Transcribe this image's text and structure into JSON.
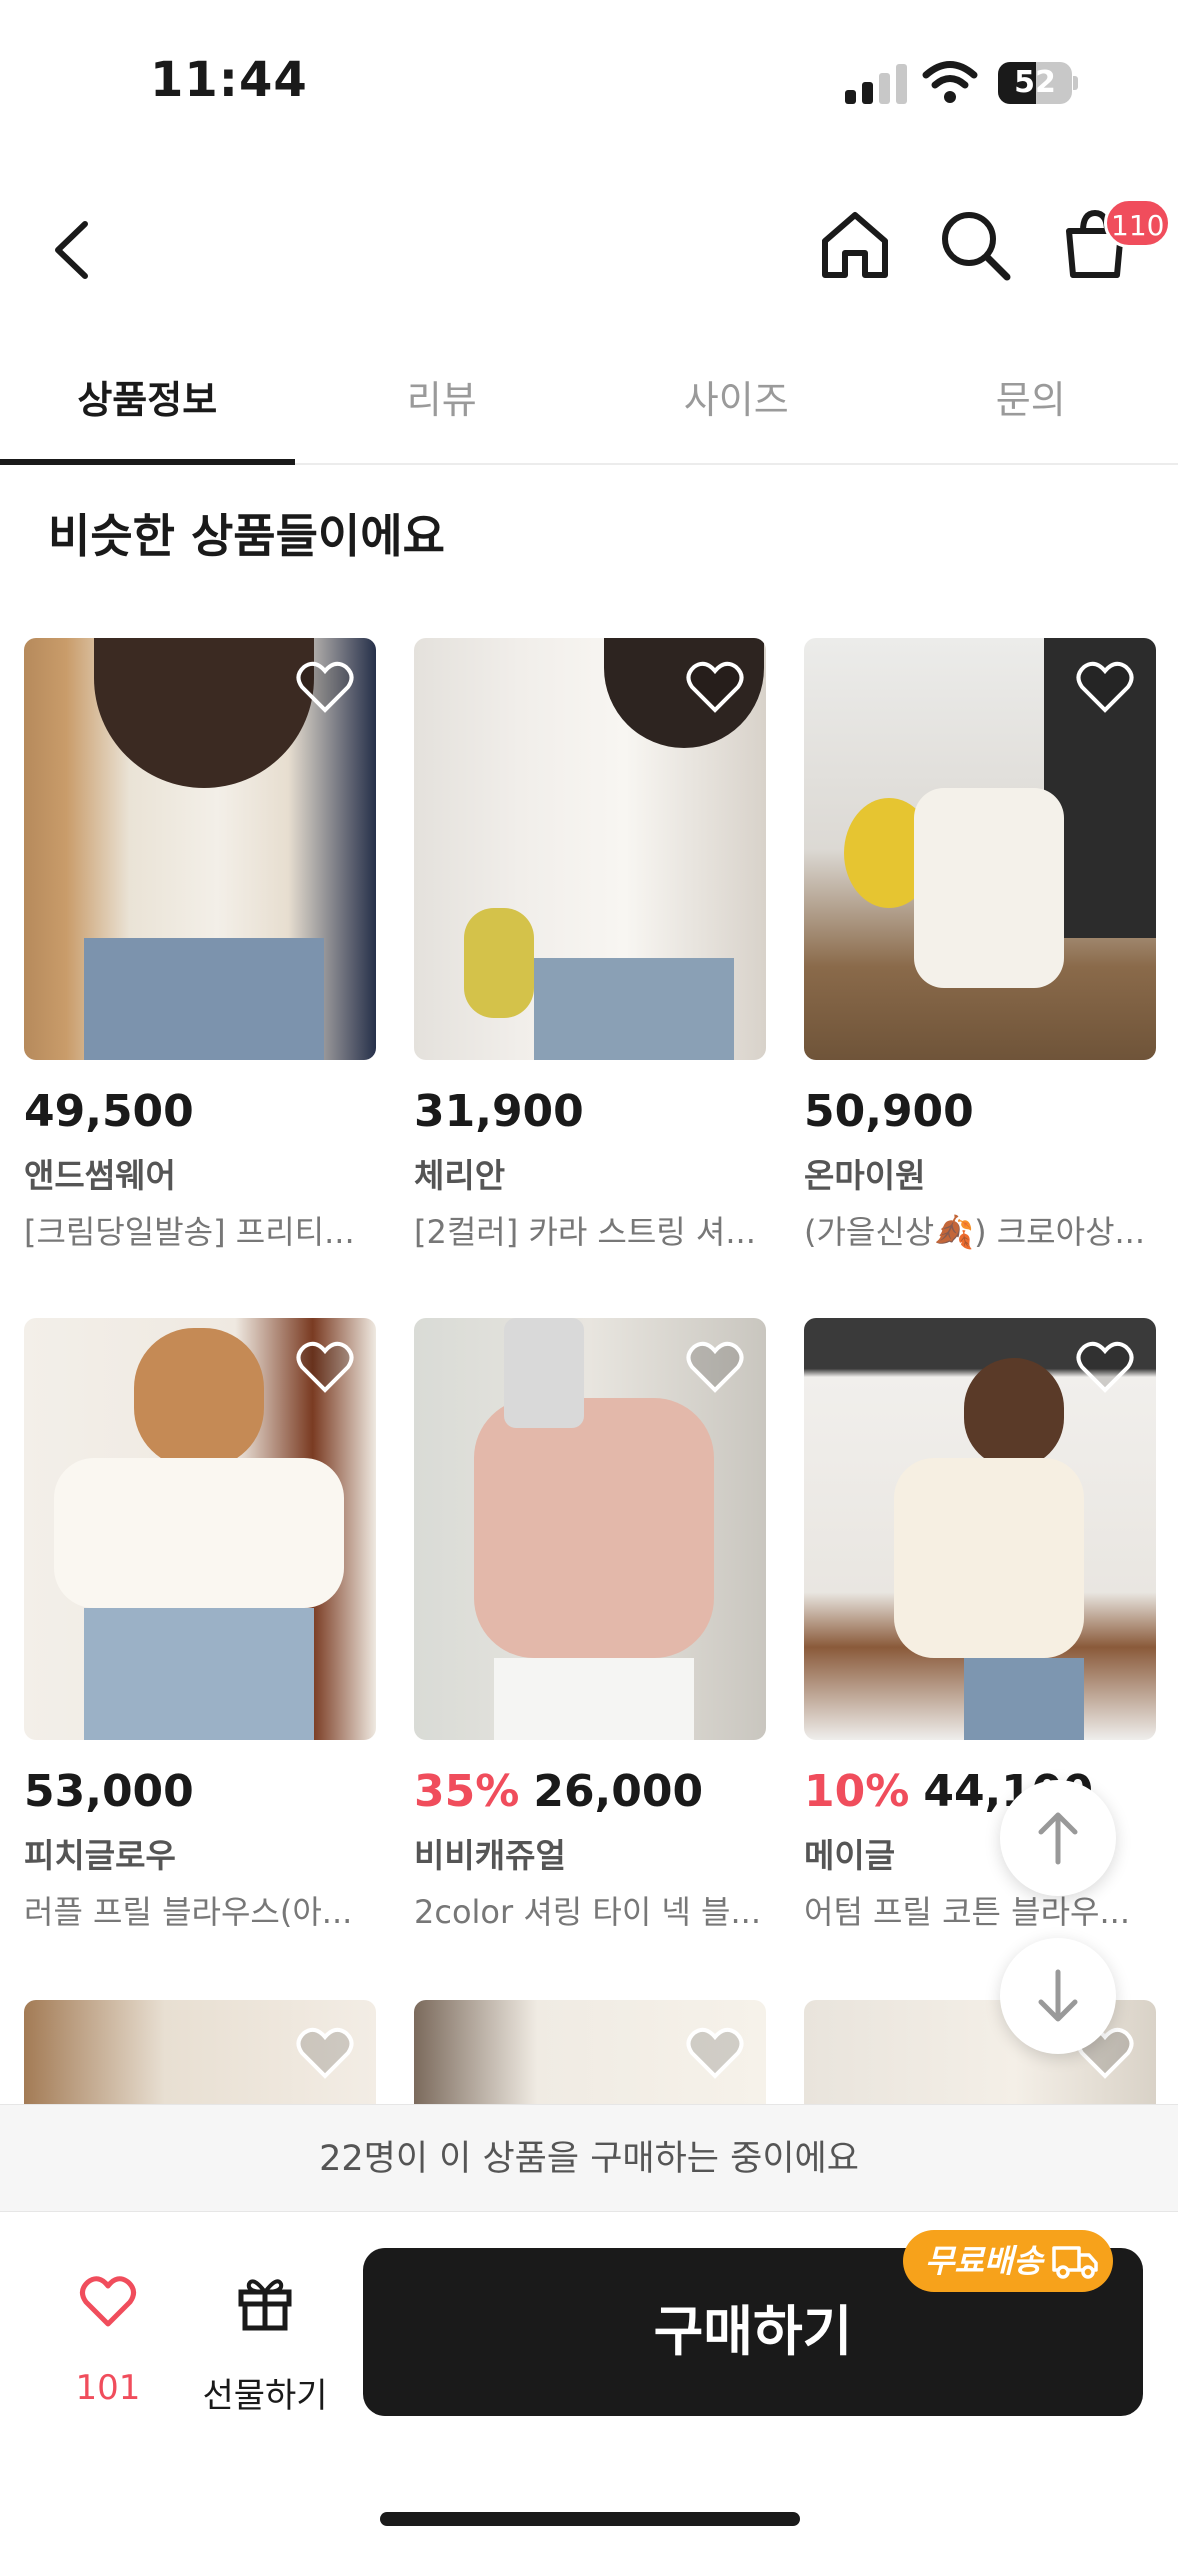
{
  "status_bar": {
    "time": "11:44",
    "battery": "52"
  },
  "header": {
    "cart_badge": "110"
  },
  "tabs": [
    {
      "label": "상품정보",
      "active": true
    },
    {
      "label": "리뷰",
      "active": false
    },
    {
      "label": "사이즈",
      "active": false
    },
    {
      "label": "문의",
      "active": false
    }
  ],
  "section": {
    "title": "비슷한 상품들이에요"
  },
  "products": [
    {
      "price": "49,500",
      "discount": "",
      "brand": "앤드썸웨어",
      "name": "[크림당일발송] 프리티..."
    },
    {
      "price": "31,900",
      "discount": "",
      "brand": "체리안",
      "name": "[2컬러] 카라 스트링 셔..."
    },
    {
      "price": "50,900",
      "discount": "",
      "brand": "온마이원",
      "name": "(가을신상🍂) 크로아상..."
    },
    {
      "price": "53,000",
      "discount": "",
      "brand": "피치글로우",
      "name": "러플 프릴 블라우스(아..."
    },
    {
      "price": "26,000",
      "discount": "35%",
      "brand": "비비캐쥬얼",
      "name": "2color 셔링 타이 넥 블..."
    },
    {
      "price": "44,100",
      "discount": "10%",
      "brand": "메이글",
      "name": "어텀 프릴 코튼 블라우..."
    }
  ],
  "notice": {
    "text": "22명이 이 상품을 구매하는 중이에요"
  },
  "bottom": {
    "like_count": "101",
    "gift_label": "선물하기",
    "buy_label": "구매하기",
    "free_shipping_label": "무료배송"
  },
  "colors": {
    "accent": "#f04d5c",
    "shipping": "#f7a21b",
    "button": "#1a1a1a"
  },
  "icons": [
    "back-icon",
    "home-icon",
    "search-icon",
    "cart-icon",
    "heart-icon",
    "gift-icon",
    "truck-icon",
    "arrow-up-icon",
    "arrow-down-icon"
  ]
}
